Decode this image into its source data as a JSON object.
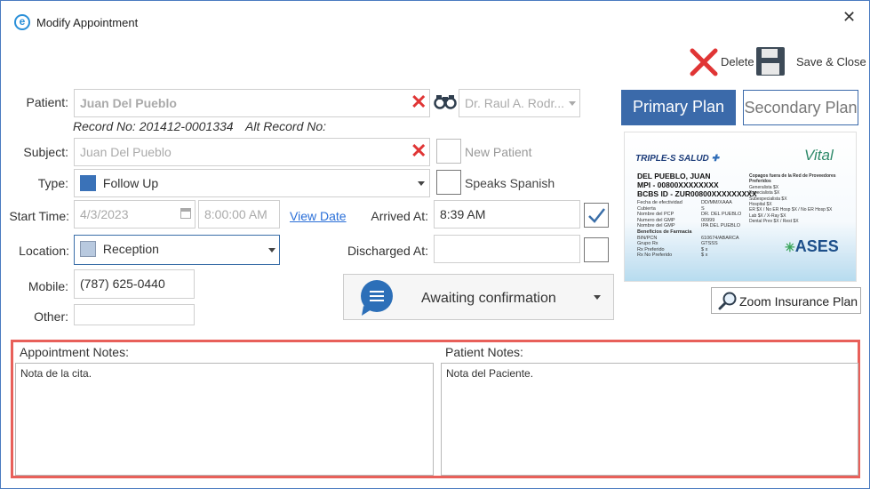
{
  "window": {
    "title": "Modify Appointment"
  },
  "toolbar": {
    "delete_label": "Delete",
    "save_close_label": "Save & Close"
  },
  "patient": {
    "label": "Patient:",
    "value": "Juan Del Pueblo",
    "record_no": "Record No: 201412-0001334",
    "alt_record": "Alt Record No:",
    "doctor": "Dr. Raul A. Rodr..."
  },
  "subject": {
    "label": "Subject:",
    "value": "Juan Del Pueblo",
    "new_patient_label": "New Patient"
  },
  "type": {
    "label": "Type:",
    "value": "Follow Up",
    "color": "#3a72b8",
    "speaks_spanish_label": "Speaks Spanish"
  },
  "start_time": {
    "label": "Start Time:",
    "date": "4/3/2023",
    "time": "8:00:00 AM",
    "view_date_link": "View Date"
  },
  "arrived": {
    "label": "Arrived At:",
    "value": "8:39 AM",
    "checked": true
  },
  "location": {
    "label": "Location:",
    "value": "Reception",
    "color": "#b8c9df"
  },
  "discharged": {
    "label": "Discharged At:",
    "value": ""
  },
  "mobile": {
    "label": "Mobile:",
    "value": "(787) 625-0440"
  },
  "other": {
    "label": "Other:",
    "value": ""
  },
  "status": {
    "value": "Awaiting confirmation"
  },
  "plans": {
    "primary": "Primary Plan",
    "secondary": "Secondary Plan",
    "zoom": "Zoom Insurance Plan"
  },
  "insurance_card": {
    "insurer": "TRIPLE-S SALUD",
    "name": "DEL PUEBLO, JUAN",
    "mpi": "MPI - 00800XXXXXXXX",
    "bcbs": "BCBS ID - ZUR00800XXXXXXXXX",
    "rows_left": [
      "Fecha de efectividad",
      "Cubierta",
      "Nombre del PCP",
      "Numero del GMP",
      "Nombre del GMP",
      "Beneficios de Farmacia",
      "BIN/PCN",
      "Grupo Rx",
      "Rx Preferido",
      "Rx No Preferido"
    ],
    "rows_mid": [
      "DD/MM/XAAA",
      "S",
      "DR. DEL PUEBLO",
      "00999",
      "IPA DEL PUEBLO",
      "",
      "610674/ABARCA",
      "GTSSS",
      "$ x",
      "$ x"
    ],
    "right_header": "Copagos fuera de la Red de Proveedores Preferidos",
    "rows_right": [
      "Generalista  $X",
      "Especialista  $X",
      "Subespecialista  $X",
      "Hospital  $X",
      "ER $X / No ER Hosp $X / No ER Hosp $X",
      "Lab $X / X-Ray $X",
      "Dental Prev $X / Rest $X"
    ],
    "brand_vital": "Vital",
    "brand_ases": "ASES"
  },
  "notes": {
    "appointment_label": "Appointment Notes:",
    "appointment_text": "Nota de la cita.",
    "patient_label": "Patient Notes:",
    "patient_text": "Nota del Paciente."
  }
}
